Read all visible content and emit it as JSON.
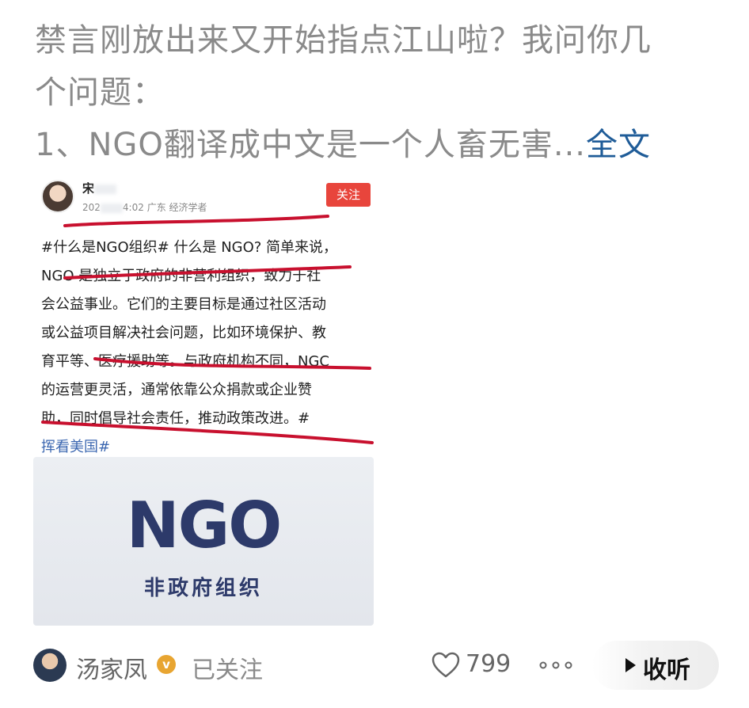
{
  "post": {
    "lines": [
      "禁言刚放出来又开始指点江山啦？我问你几",
      "个问题：",
      "1、NGO翻译成中文是一个人畜无害..."
    ],
    "more_label": "全文"
  },
  "screenshot": {
    "author_name": "宋",
    "meta_prefix": "202",
    "meta_time": "4:02",
    "meta_suffix": "广东 经济学者",
    "follow_label": "关注",
    "body_lines": [
      "#什么是NGO组织# 什么是 NGO? 简单来说，",
      "NGO 是独立于政府的非营利组织，致力于社",
      "会公益事业。它们的主要目标是通过社区活动",
      "或公益项目解决社会问题，比如环境保护、教",
      "育平等、医疗援助等。与政府机构不同，NGC",
      "的运营更灵活，通常依靠公众捐款或企业赞",
      "助，同时倡导社会责任，推动政策改进。#"
    ],
    "tag_line": "挥看美国#",
    "image_title": "NGO",
    "image_subtitle": "非政府组织",
    "underline_color": "#c8102e"
  },
  "footer": {
    "user_name": "汤家凤",
    "verify_mark": "v",
    "follow_state": "已关注",
    "like_count": "799",
    "more_symbol": "○○○",
    "listen_label": "收听"
  }
}
